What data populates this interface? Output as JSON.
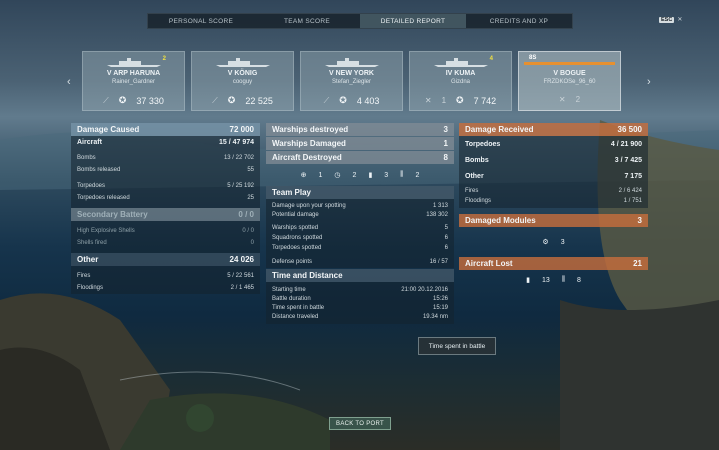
{
  "tabs": [
    "PERSONAL SCORE",
    "TEAM SCORE",
    "DETAILED REPORT",
    "CREDITS AND XP"
  ],
  "active_tab": 2,
  "esc_hint": {
    "key": "ESC",
    "icon": "close-icon"
  },
  "nav": {
    "left": "‹",
    "right": "›"
  },
  "ships": [
    {
      "tier": "V ARP HARUNA",
      "player": "Rainer_Gardner",
      "badge": "2",
      "left_icon": "torpedo-icon",
      "score": "37 330"
    },
    {
      "tier": "V KÖNIG",
      "player": "cooguy",
      "badge": "",
      "left_icon": "torpedo-icon",
      "score": "22 525"
    },
    {
      "tier": "V NEW YORK",
      "player": "Stefan_Ziegler",
      "badge": "",
      "left_icon": "torpedo-icon",
      "score": "4 403"
    },
    {
      "tier": "IV KUMA",
      "player": "Gizdna",
      "badge": "4",
      "left_icon": "skull-icon",
      "left_value": "1",
      "score": "7 742"
    },
    {
      "tier": "V BOGUE",
      "player": "FRZDKOSe_96_60",
      "badge": "",
      "left_icon": "skull-icon",
      "left_value": "2",
      "score": "",
      "num": "8S",
      "selected": true
    }
  ],
  "damage_caused": {
    "title": "Damage Caused",
    "value": "72 000",
    "rows": [
      {
        "label": "Aircraft",
        "value": "15 / 47 974",
        "bold": true
      },
      {
        "label": "Bombs",
        "value": "13 / 22 702"
      },
      {
        "label": "Bombs released",
        "value": "55"
      },
      {
        "label": "Torpedoes",
        "value": "5 / 25 192"
      },
      {
        "label": "Torpedoes released",
        "value": "25"
      }
    ],
    "secondary": {
      "title": "Secondary Battery",
      "value": "0 / 0",
      "rows": [
        {
          "label": "High Explosive Shells",
          "value": "0 / 0"
        },
        {
          "label": "Shells fired",
          "value": "0"
        }
      ]
    },
    "other": {
      "title": "Other",
      "value": "24 026",
      "rows": [
        {
          "label": "Fires",
          "value": "5 / 22 561"
        },
        {
          "label": "Floodings",
          "value": "2 / 1 465"
        }
      ]
    }
  },
  "middle": {
    "warships_destroyed": {
      "label": "Warships destroyed",
      "value": "3"
    },
    "warships_damaged": {
      "label": "Warships Damaged",
      "value": "1"
    },
    "aircraft_destroyed": {
      "label": "Aircraft Destroyed",
      "value": "8"
    },
    "icons": [
      {
        "icon": "target-icon",
        "value": "1"
      },
      {
        "icon": "clock-icon",
        "value": "2"
      },
      {
        "icon": "bomber-icon",
        "value": "3"
      },
      {
        "icon": "fighter-icon",
        "value": "2"
      }
    ],
    "team_play": {
      "title": "Team Play",
      "rows": [
        {
          "label": "Damage upon your spotting",
          "value": "1 313"
        },
        {
          "label": "Potential damage",
          "value": "138 302"
        },
        {
          "label": "Warships spotted",
          "value": "5"
        },
        {
          "label": "Squadrons spotted",
          "value": "6"
        },
        {
          "label": "Torpedoes spotted",
          "value": "6"
        },
        {
          "label": "Defense points",
          "value": "16 / 57"
        }
      ]
    },
    "time_distance": {
      "title": "Time and Distance",
      "rows": [
        {
          "label": "Starting time",
          "value": "21:00 20.12.2016"
        },
        {
          "label": "Battle duration",
          "value": "15:26"
        },
        {
          "label": "Time spent in battle",
          "value": "15:19"
        },
        {
          "label": "Distance traveled",
          "value": "19.34 nm"
        }
      ]
    }
  },
  "damage_received": {
    "title": "Damage Received",
    "value": "36 500",
    "rows": [
      {
        "label": "Torpedoes",
        "value": "4 / 21 900",
        "bold": true
      },
      {
        "label": "Bombs",
        "value": "3 / 7 425",
        "bold": true
      },
      {
        "label": "Other",
        "value": "7 175",
        "bold": true
      },
      {
        "label": "Fires",
        "value": "2 / 6 424"
      },
      {
        "label": "Floodings",
        "value": "1 / 751"
      }
    ]
  },
  "damaged_modules": {
    "title": "Damaged Modules",
    "value": "3",
    "icon": "module-icon",
    "icon_value": "3"
  },
  "aircraft_lost": {
    "title": "Aircraft Lost",
    "value": "21",
    "icons": [
      {
        "icon": "bomber-icon",
        "value": "13"
      },
      {
        "icon": "fighter-icon",
        "value": "8"
      }
    ]
  },
  "tooltip": "Time spent in battle",
  "back_button": "BACK TO PORT",
  "colors": {
    "accent_orange": "#c86e3c",
    "accent_blue": "#7896aa",
    "badge_yellow": "#f0e040"
  }
}
